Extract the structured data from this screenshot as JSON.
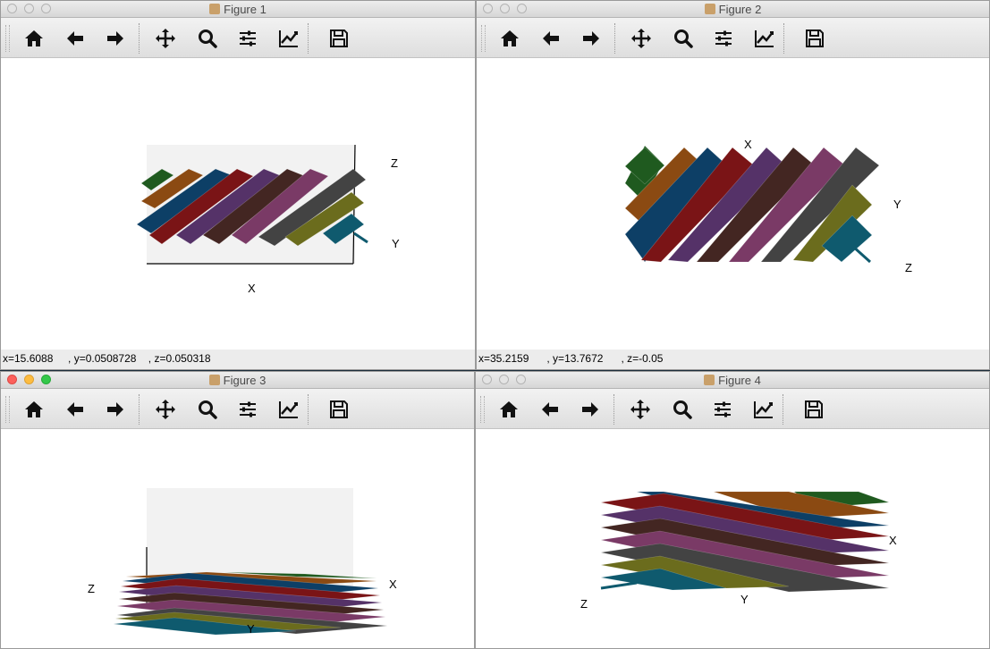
{
  "colors": {
    "green": "#1f5a1f",
    "orange": "#8b4a12",
    "blue": "#0d3f66",
    "red": "#7a1416",
    "purple": "#553268",
    "brown": "#432622",
    "pink": "#7a3a66",
    "gray": "#434343",
    "olive": "#6b6c1d",
    "teal": "#0f5a6e",
    "pane": "#f2f2f2"
  },
  "toolbar_icons": [
    "home-icon",
    "back-arrow-icon",
    "forward-arrow-icon",
    "pan-icon",
    "zoom-icon",
    "subplots-icon",
    "edit-curves-icon",
    "save-icon"
  ],
  "windows": [
    {
      "title": "Figure 1",
      "status": "x=15.6088     , y=0.0508728    , z=0.050318",
      "labels": {
        "a": "Z",
        "b": "Y",
        "c": "X"
      }
    },
    {
      "title": "Figure 2",
      "status": "x=35.2159      , y=13.7672      , z=-0.05",
      "labels": {
        "a": "X",
        "b": "Y",
        "c": "Z"
      }
    },
    {
      "title": "Figure 3",
      "status": "",
      "labels": {
        "a": "Z",
        "b": "X",
        "c": "Y"
      }
    },
    {
      "title": "Figure 4",
      "status": "",
      "labels": {
        "a": "X",
        "b": "Z",
        "c": "Y"
      }
    }
  ]
}
